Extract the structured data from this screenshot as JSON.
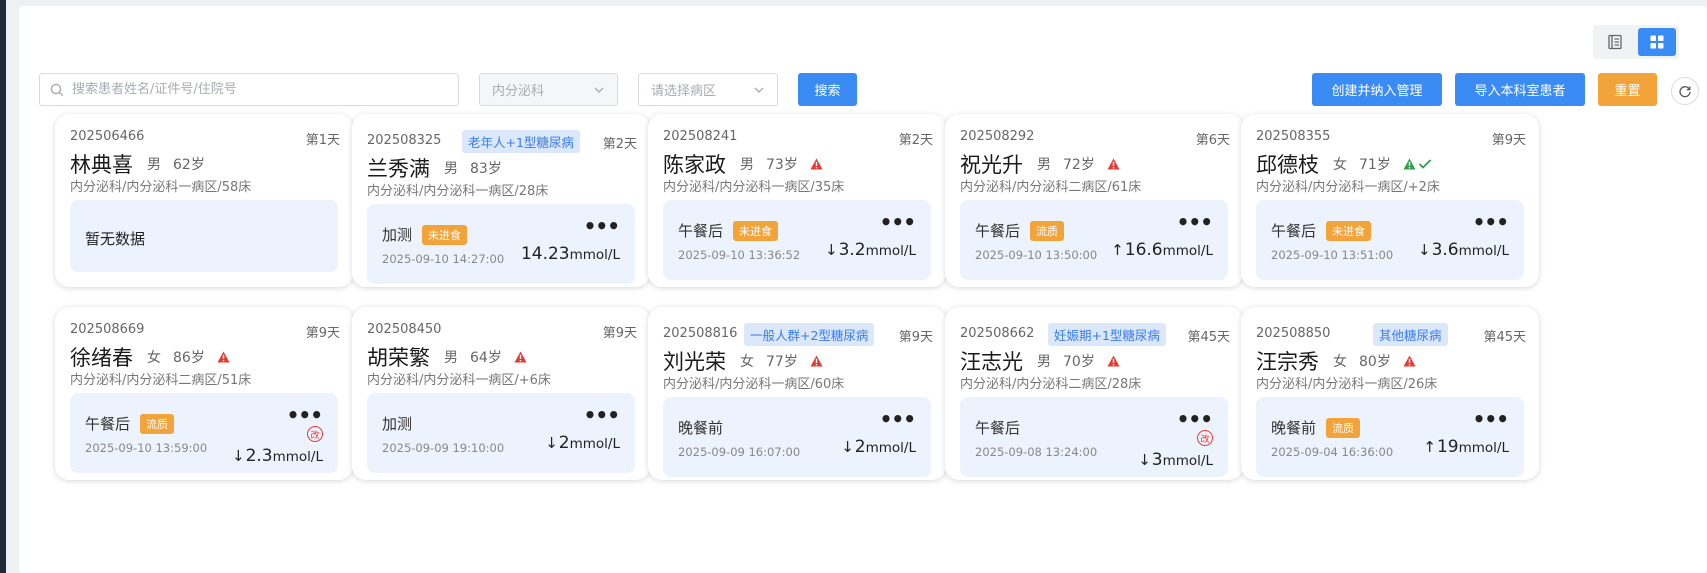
{
  "toolbar": {
    "search_placeholder": "搜索患者姓名/证件号/住院号",
    "dept_value": "内分泌科",
    "ward_placeholder": "请选择病区",
    "search_label": "搜索",
    "create_label": "创建并纳入管理",
    "import_label": "导入本科室患者",
    "reset_label": "重置"
  },
  "colors": {
    "primary": "#3b8bf5",
    "warning": "#f2a43a",
    "danger": "#e53935",
    "tag_bg": "#dbe8fb",
    "card_inner_bg": "#edf3fc"
  },
  "patients": [
    {
      "id": "202506466",
      "day": "第1天",
      "tag": "",
      "name": "林典喜",
      "gender": "男",
      "age": "62岁",
      "loc": "内分泌科/内分泌科一病区/58床",
      "alerts": [],
      "nodata": "暂无数据"
    },
    {
      "id": "202508325",
      "day": "第2天",
      "tag": "老年人+1型糖尿病",
      "name": "兰秀满",
      "gender": "男",
      "age": "83岁",
      "loc": "内分泌科/内分泌科一病区/28床",
      "alerts": [],
      "meal": "加测",
      "meal_tag": "未进食",
      "time": "2025-09-10 14:27:00",
      "arrow": "",
      "value": "14.23",
      "unit": "mmol/L",
      "modified": false
    },
    {
      "id": "202508241",
      "day": "第2天",
      "tag": "",
      "name": "陈家政",
      "gender": "男",
      "age": "73岁",
      "loc": "内分泌科/内分泌科一病区/35床",
      "alerts": [
        "warning-red"
      ],
      "meal": "午餐后",
      "meal_tag": "未进食",
      "time": "2025-09-10 13:36:52",
      "arrow": "↓",
      "value": "3.2",
      "unit": "mmol/L",
      "modified": false
    },
    {
      "id": "202508292",
      "day": "第6天",
      "tag": "",
      "name": "祝光升",
      "gender": "男",
      "age": "72岁",
      "loc": "内分泌科/内分泌科二病区/61床",
      "alerts": [
        "warning-red"
      ],
      "meal": "午餐后",
      "meal_tag": "流质",
      "time": "2025-09-10 13:50:00",
      "arrow": "↑",
      "value": "16.6",
      "unit": "mmol/L",
      "modified": false
    },
    {
      "id": "202508355",
      "day": "第9天",
      "tag": "",
      "name": "邱德枝",
      "gender": "女",
      "age": "71岁",
      "loc": "内分泌科/内分泌科一病区/+2床",
      "alerts": [
        "warning-green",
        "check"
      ],
      "meal": "午餐后",
      "meal_tag": "未进食",
      "time": "2025-09-10 13:51:00",
      "arrow": "↓",
      "value": "3.6",
      "unit": "mmol/L",
      "modified": false
    },
    {
      "id": "202508669",
      "day": "第9天",
      "tag": "",
      "name": "徐绪春",
      "gender": "女",
      "age": "86岁",
      "loc": "内分泌科/内分泌科二病区/51床",
      "alerts": [
        "warning-red"
      ],
      "meal": "午餐后",
      "meal_tag": "流质",
      "time": "2025-09-10 13:59:00",
      "arrow": "↓",
      "value": "2.3",
      "unit": "mmol/L",
      "modified": true,
      "modified_label": "改"
    },
    {
      "id": "202508450",
      "day": "第9天",
      "tag": "",
      "name": "胡荣繁",
      "gender": "男",
      "age": "64岁",
      "loc": "内分泌科/内分泌科一病区/+6床",
      "alerts": [
        "warning-red"
      ],
      "meal": "加测",
      "meal_tag": "",
      "time": "2025-09-09 19:10:00",
      "arrow": "↓",
      "value": "2",
      "unit": "mmol/L",
      "modified": false
    },
    {
      "id": "202508816",
      "day": "第9天",
      "tag": "一般人群+2型糖尿病",
      "name": "刘光荣",
      "gender": "女",
      "age": "77岁",
      "loc": "内分泌科/内分泌科一病区/60床",
      "alerts": [
        "warning-red"
      ],
      "meal": "晚餐前",
      "meal_tag": "",
      "time": "2025-09-09 16:07:00",
      "arrow": "↓",
      "value": "2",
      "unit": "mmol/L",
      "modified": false
    },
    {
      "id": "202508662",
      "day": "第45天",
      "tag": "妊娠期+1型糖尿病",
      "name": "汪志光",
      "gender": "男",
      "age": "70岁",
      "loc": "内分泌科/内分泌科二病区/28床",
      "alerts": [
        "warning-red"
      ],
      "meal": "午餐后",
      "meal_tag": "",
      "time": "2025-09-08 13:24:00",
      "arrow": "↓",
      "value": "3",
      "unit": "mmol/L",
      "modified": true,
      "modified_label": "改"
    },
    {
      "id": "202508850",
      "day": "第45天",
      "tag": "其他糖尿病",
      "name": "汪宗秀",
      "gender": "女",
      "age": "80岁",
      "loc": "内分泌科/内分泌科一病区/26床",
      "alerts": [
        "warning-red"
      ],
      "meal": "晚餐前",
      "meal_tag": "流质",
      "time": "2025-09-04 16:36:00",
      "arrow": "↑",
      "value": "19",
      "unit": "mmol/L",
      "modified": false
    }
  ]
}
